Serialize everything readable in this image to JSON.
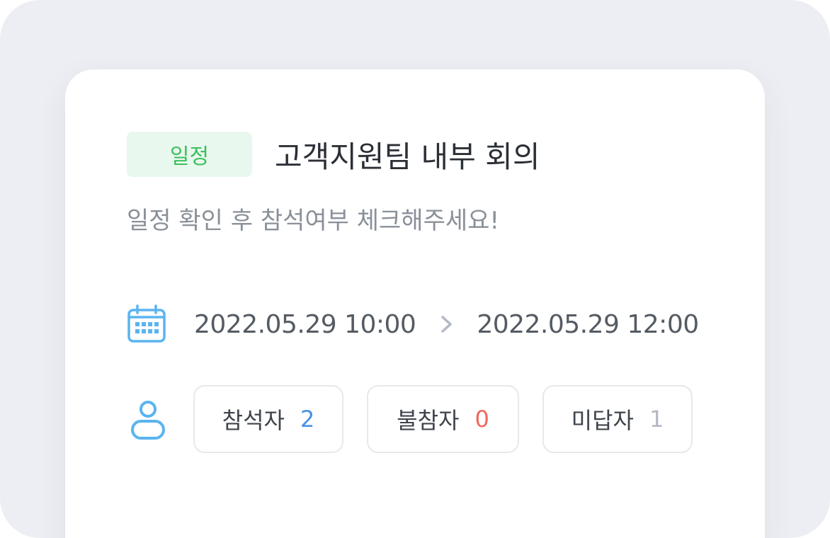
{
  "event": {
    "category": "일정",
    "title": "고객지원팀 내부 회의",
    "description": "일정 확인 후 참석여부 체크해주세요!"
  },
  "schedule": {
    "start": "2022.05.29 10:00",
    "end": "2022.05.29 12:00"
  },
  "attendance": [
    {
      "label": "참석자",
      "count": "2"
    },
    {
      "label": "불참자",
      "count": "0"
    },
    {
      "label": "미답자",
      "count": "1"
    }
  ],
  "icons": {
    "calendar": "calendar-icon",
    "arrow": "chevron-right-icon",
    "user": "user-icon"
  },
  "colors": {
    "tag_bg": "#e9f8ee",
    "tag_text": "#3cbf5c",
    "icon_blue": "#5ab4f0",
    "attend_count": "#4a90e2",
    "absent_count": "#f26560",
    "pending_count": "#b3b9c2"
  }
}
